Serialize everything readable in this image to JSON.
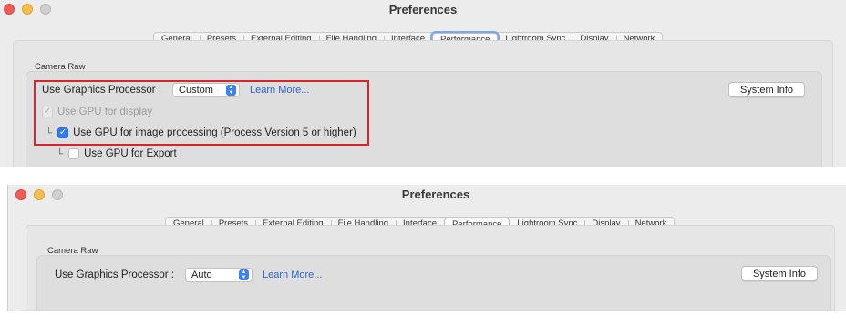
{
  "top_window": {
    "title": "Preferences",
    "tabs": [
      "General",
      "Presets",
      "External Editing",
      "File Handling",
      "Interface",
      "Performance",
      "Lightroom Sync",
      "Display",
      "Network"
    ],
    "selected_tab": "Performance",
    "section_label": "Camera Raw",
    "gpu_label": "Use Graphics Processor :",
    "gpu_value": "Custom",
    "learn_more": "Learn More...",
    "system_info": "System Info",
    "gpu_display_label": "Use GPU for display",
    "gpu_display_checked": true,
    "gpu_processing_label": "Use GPU for image processing (Process Version 5 or higher)",
    "gpu_processing_checked": true,
    "gpu_export_label": "Use GPU for Export",
    "gpu_export_checked": false,
    "highlight_color": "#d6262b"
  },
  "bottom_window": {
    "title": "Preferences",
    "tabs": [
      "General",
      "Presets",
      "External Editing",
      "File Handling",
      "Interface",
      "Performance",
      "Lightroom Sync",
      "Display",
      "Network"
    ],
    "selected_tab": "Performance",
    "section_label": "Camera Raw",
    "gpu_label": "Use Graphics Processor :",
    "gpu_value": "Auto",
    "learn_more": "Learn More...",
    "system_info": "System Info"
  },
  "check_glyph": "✓",
  "tree_glyph": "└",
  "stepper_glyphs": [
    "▲",
    "▼"
  ]
}
